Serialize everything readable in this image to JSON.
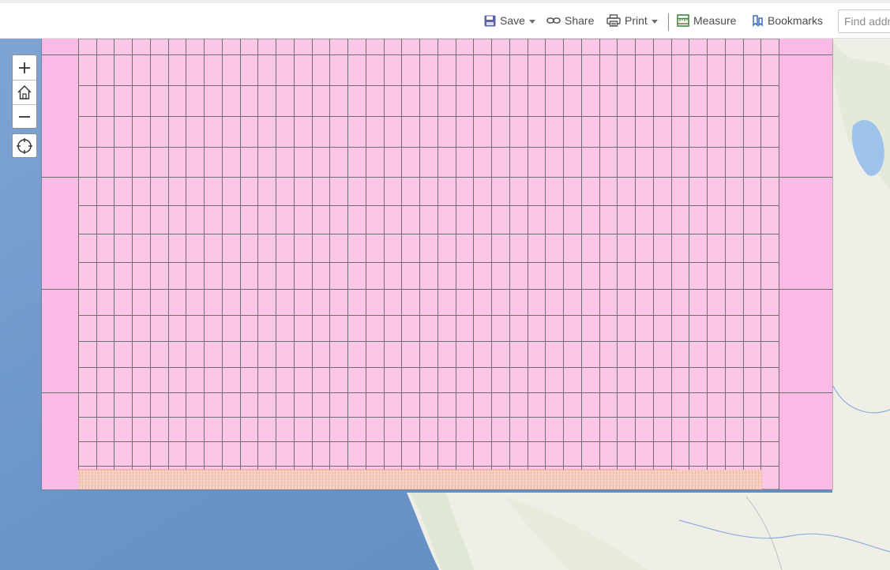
{
  "toolbar": {
    "save_label": "Save",
    "share_label": "Share",
    "print_label": "Print",
    "measure_label": "Measure",
    "bookmarks_label": "Bookmarks",
    "search_placeholder": "Find address or place"
  },
  "icons": {
    "save": "save-icon",
    "share": "link-icon",
    "print": "printer-icon",
    "measure": "ruler-icon",
    "bookmarks": "bookmark-icon",
    "zoom_in": "plus-icon",
    "home": "home-icon",
    "zoom_out": "minus-icon",
    "locate": "locate-icon"
  },
  "colors": {
    "grid_fill": "#fbc6e7",
    "grid_fill_side": "#f9bbe5",
    "grid_line": "#6f6f6f",
    "hatch_fill": "#f3c9b6",
    "hatch_line": "#e79477",
    "ocean": "#6f99cc",
    "land": "#efeee9",
    "save_icon": "#5b62a6",
    "measure_icon": "#3b8a3b",
    "bookmark_icon": "#3a6fb5"
  }
}
